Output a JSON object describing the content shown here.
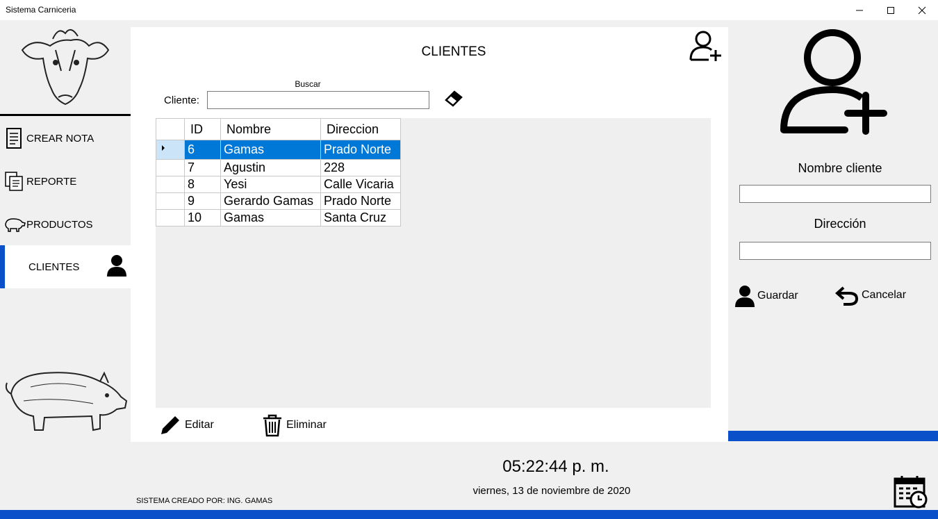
{
  "window": {
    "title": "Sistema Carniceria"
  },
  "sidebar": {
    "items": [
      {
        "label": "CREAR NOTA"
      },
      {
        "label": "REPORTE"
      },
      {
        "label": "PRODUCTOS"
      },
      {
        "label": "CLIENTES"
      }
    ],
    "active": "CLIENTES",
    "credit": "SISTEMA CREADO POR: ING. GAMAS"
  },
  "center": {
    "title": "CLIENTES",
    "search_caption": "Buscar",
    "search_label": "Cliente:",
    "search_value": "",
    "table": {
      "columns": [
        "ID",
        "Nombre",
        "Direccion"
      ],
      "rows": [
        {
          "id": "6",
          "nombre": "Gamas",
          "direccion": "Prado Norte",
          "selected": true
        },
        {
          "id": "7",
          "nombre": "Agustin",
          "direccion": "228"
        },
        {
          "id": "8",
          "nombre": "Yesi",
          "direccion": "Calle Vicaria"
        },
        {
          "id": "9",
          "nombre": "Gerardo Gamas",
          "direccion": "Prado Norte"
        },
        {
          "id": "10",
          "nombre": "Gamas",
          "direccion": "Santa Cruz"
        }
      ]
    },
    "edit_label": "Editar",
    "delete_label": "Eliminar"
  },
  "form": {
    "name_label": "Nombre cliente",
    "name_value": "",
    "address_label": "Dirección",
    "address_value": "",
    "save_label": "Guardar",
    "cancel_label": "Cancelar"
  },
  "footer": {
    "time": "05:22:44 p. m.",
    "date": "viernes, 13 de noviembre de 2020"
  },
  "colors": {
    "accent": "#0a50c8",
    "selection": "#0078d7"
  }
}
